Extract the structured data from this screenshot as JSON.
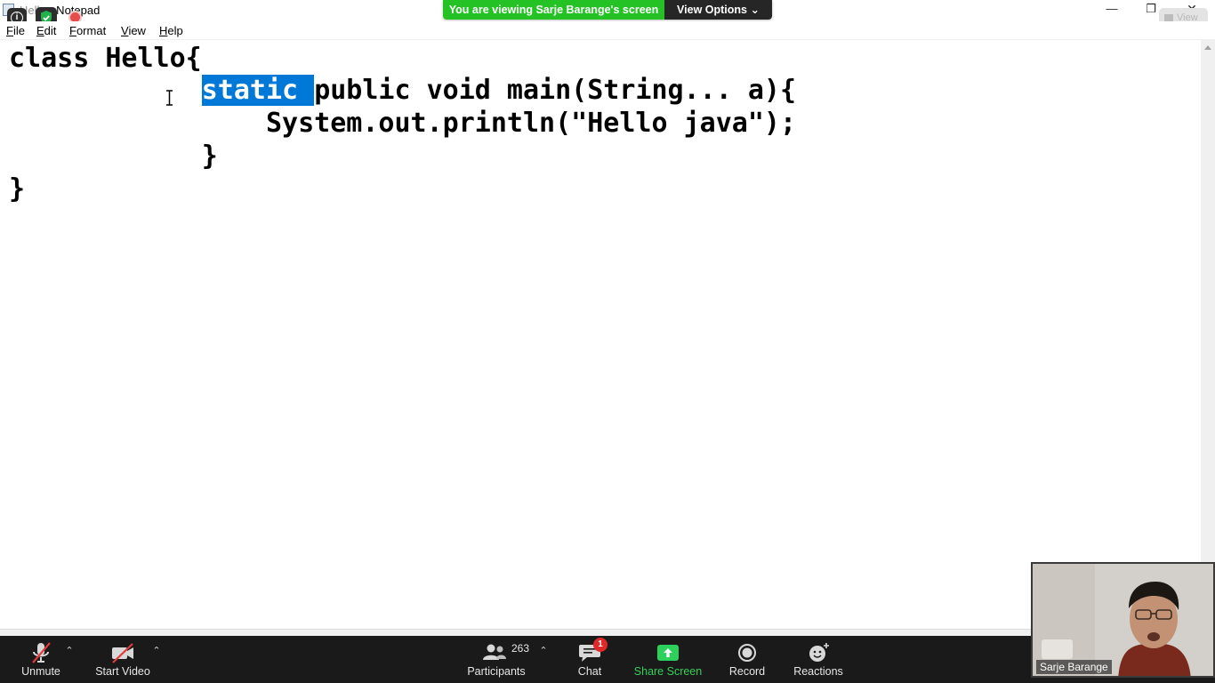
{
  "window": {
    "title": "Hello - Notepad",
    "controls": {
      "minimize": "—",
      "restore": "❐",
      "close": "✕"
    }
  },
  "menu": [
    {
      "access": "F",
      "rest": "ile"
    },
    {
      "access": "E",
      "rest": "dit"
    },
    {
      "access": "F",
      "rest": "ormat",
      "plain": true,
      "label": "Format"
    },
    {
      "access": "V",
      "rest": "iew"
    },
    {
      "access": "H",
      "rest": "elp"
    }
  ],
  "menu_labels": {
    "file_a": "F",
    "file_b": "ile",
    "edit_a": "E",
    "edit_b": "dit",
    "format_a": "F",
    "format_b": "ormat",
    "view_a": "V",
    "view_b": "iew",
    "help_a": "H",
    "help_b": "elp"
  },
  "editor": {
    "lines": [
      "class Hello{",
      "\t",
      "\t\t    System.out.println(\"Hello java\");",
      "\t    }",
      "}"
    ],
    "line2_indent": "            ",
    "line2_selected": "static ",
    "line2_rest": "public void main(String... a){",
    "line3": "                System.out.println(\"Hello java\");",
    "line4": "            }",
    "line5": "}",
    "line1": "class Hello{"
  },
  "zoom": {
    "banner_text": "You are viewing Sarje Barange's screen",
    "view_options": "View Options ⌄",
    "view_button": "View",
    "info_icon_char": "i",
    "toolbar": {
      "unmute": "Unmute",
      "start_video": "Start Video",
      "participants": "Participants",
      "participant_count": "263",
      "chat": "Chat",
      "chat_badge": "1",
      "share_screen": "Share Screen",
      "record": "Record",
      "reactions": "Reactions",
      "caret": "⌃"
    },
    "video_name": "Sarje Barange"
  },
  "colors": {
    "selection": "#0078d7",
    "banner_green": "#25c226",
    "toolbar_bg": "#1a1a1a",
    "share_green": "#34d15a",
    "badge_red": "#e02828",
    "mute_red": "#e03b3b"
  }
}
